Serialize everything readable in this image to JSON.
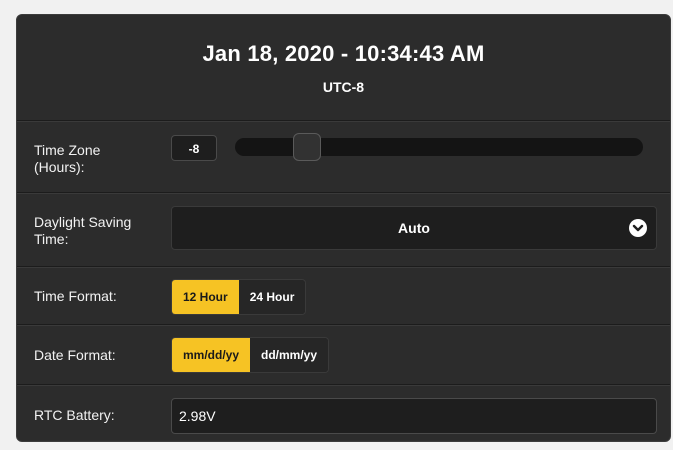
{
  "header": {
    "datetime": "Jan 18, 2020 - 10:34:43 AM",
    "timezone": "UTC-8"
  },
  "time_zone": {
    "label_line1": "Time Zone",
    "label_line2": "(Hours):",
    "value": "-8",
    "slider_min": -12,
    "slider_max": 14,
    "slider_value": -8
  },
  "daylight_saving": {
    "label_line1": "Daylight Saving",
    "label_line2": "Time:",
    "selected": "Auto"
  },
  "time_format": {
    "label": "Time Format:",
    "options": [
      "12 Hour",
      "24 Hour"
    ],
    "active": "12 Hour"
  },
  "date_format": {
    "label": "Date Format:",
    "options": [
      "mm/dd/yy",
      "dd/mm/yy"
    ],
    "active": "mm/dd/yy"
  },
  "rtc_battery": {
    "label": "RTC Battery:",
    "value": "2.98V"
  },
  "colors": {
    "accent": "#f6c324",
    "panel": "#2c2c2c"
  },
  "icons": {
    "dst_dropdown": "chevron-down-icon"
  }
}
